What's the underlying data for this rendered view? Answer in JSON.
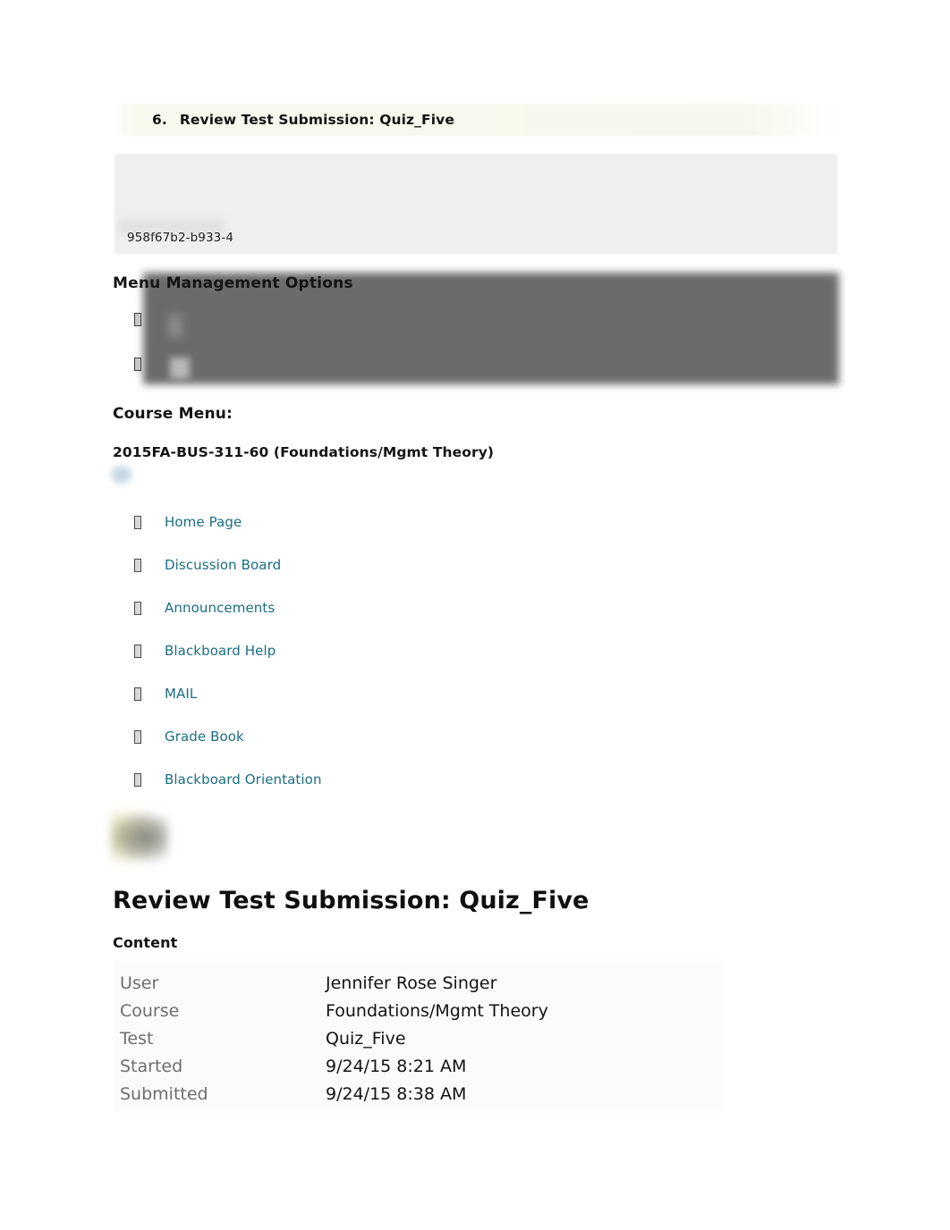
{
  "top_item": {
    "number": "6.",
    "title": "Review Test Submission: Quiz_Five"
  },
  "panel": {
    "id_text": "958f67b2-b933-4"
  },
  "menu_management": {
    "heading": "Menu Management Options",
    "items": [
      {
        "marker": "missing-glyph-box",
        "label": ""
      },
      {
        "marker": "missing-glyph-box",
        "label": ""
      }
    ]
  },
  "course_menu": {
    "heading": "Course Menu:",
    "course_code": "2015FA-BUS-311-60 (Foundations/Mgmt Theory)",
    "items": [
      {
        "label": "Home Page"
      },
      {
        "label": "Discussion Board"
      },
      {
        "label": "Announcements"
      },
      {
        "label": "Blackboard Help"
      },
      {
        "label": "MAIL"
      },
      {
        "label": "Grade Book"
      },
      {
        "label": "Blackboard Orientation"
      }
    ]
  },
  "main": {
    "title": "Review Test Submission: Quiz_Five",
    "content_heading": "Content",
    "details": [
      {
        "label": "User",
        "value": "Jennifer Rose Singer"
      },
      {
        "label": "Course",
        "value": "Foundations/Mgmt Theory"
      },
      {
        "label": "Test",
        "value": "Quiz_Five"
      },
      {
        "label": "Started",
        "value": "9/24/15 8:21 AM"
      },
      {
        "label": "Submitted",
        "value": "9/24/15 8:38 AM"
      }
    ]
  },
  "colors": {
    "link": "#1a6d84",
    "heading": "#151515",
    "label": "#6d6d6d",
    "redaction_dark": "#6b6b6b",
    "panel_gray": "#efefef",
    "header_band": "#f7f7ec"
  }
}
